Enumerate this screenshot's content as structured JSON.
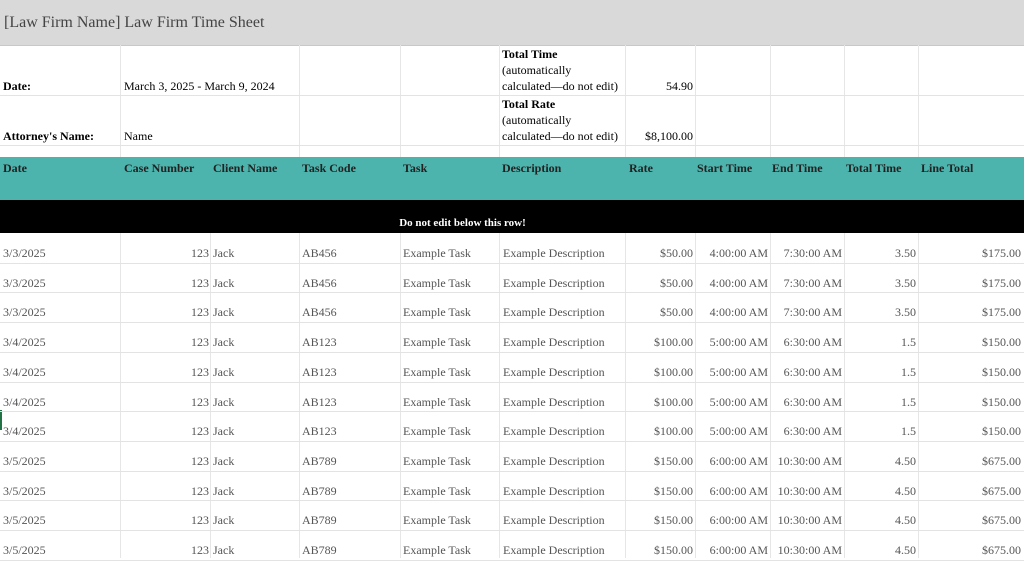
{
  "title": "[Law Firm Name] Law Firm Time Sheet",
  "summary": {
    "date_label": "Date:",
    "date_value": "March 3, 2025 - March 9, 2024",
    "attorney_label": "Attorney's Name:",
    "attorney_value": "Name",
    "total_time_label": "Total Time",
    "total_time_note1": "(automatically",
    "total_time_note2": "calculated—do not edit)",
    "total_time_value": "54.90",
    "total_rate_label": "Total Rate",
    "total_rate_note1": "(automatically",
    "total_rate_note2": "calculated—do not edit)",
    "total_rate_value": "$8,100.00"
  },
  "headers": [
    "Date",
    "Case Number",
    "Client Name",
    "Task Code",
    "Task",
    "Description",
    "Rate",
    "Start Time",
    "End Time",
    "Total Time",
    "Line Total"
  ],
  "notice": "Do not edit below this row!",
  "rows": [
    [
      "3/3/2025",
      "123",
      "Jack",
      "AB456",
      "Example Task",
      "Example Description",
      "$50.00",
      "4:00:00 AM",
      "7:30:00 AM",
      "3.50",
      "$175.00"
    ],
    [
      "3/3/2025",
      "123",
      "Jack",
      "AB456",
      "Example Task",
      "Example Description",
      "$50.00",
      "4:00:00 AM",
      "7:30:00 AM",
      "3.50",
      "$175.00"
    ],
    [
      "3/3/2025",
      "123",
      "Jack",
      "AB456",
      "Example Task",
      "Example Description",
      "$50.00",
      "4:00:00 AM",
      "7:30:00 AM",
      "3.50",
      "$175.00"
    ],
    [
      "3/4/2025",
      "123",
      "Jack",
      "AB123",
      "Example Task",
      "Example Description",
      "$100.00",
      "5:00:00 AM",
      "6:30:00 AM",
      "1.5",
      "$150.00"
    ],
    [
      "3/4/2025",
      "123",
      "Jack",
      "AB123",
      "Example Task",
      "Example Description",
      "$100.00",
      "5:00:00 AM",
      "6:30:00 AM",
      "1.5",
      "$150.00"
    ],
    [
      "3/4/2025",
      "123",
      "Jack",
      "AB123",
      "Example Task",
      "Example Description",
      "$100.00",
      "5:00:00 AM",
      "6:30:00 AM",
      "1.5",
      "$150.00"
    ],
    [
      "3/4/2025",
      "123",
      "Jack",
      "AB123",
      "Example Task",
      "Example Description",
      "$100.00",
      "5:00:00 AM",
      "6:30:00 AM",
      "1.5",
      "$150.00"
    ],
    [
      "3/5/2025",
      "123",
      "Jack",
      "AB789",
      "Example Task",
      "Example Description",
      "$150.00",
      "6:00:00 AM",
      "10:30:00 AM",
      "4.50",
      "$675.00"
    ],
    [
      "3/5/2025",
      "123",
      "Jack",
      "AB789",
      "Example Task",
      "Example Description",
      "$150.00",
      "6:00:00 AM",
      "10:30:00 AM",
      "4.50",
      "$675.00"
    ],
    [
      "3/5/2025",
      "123",
      "Jack",
      "AB789",
      "Example Task",
      "Example Description",
      "$150.00",
      "6:00:00 AM",
      "10:30:00 AM",
      "4.50",
      "$675.00"
    ],
    [
      "3/5/2025",
      "123",
      "Jack",
      "AB789",
      "Example Task",
      "Example Description",
      "$150.00",
      "6:00:00 AM",
      "10:30:00 AM",
      "4.50",
      "$675.00"
    ]
  ]
}
